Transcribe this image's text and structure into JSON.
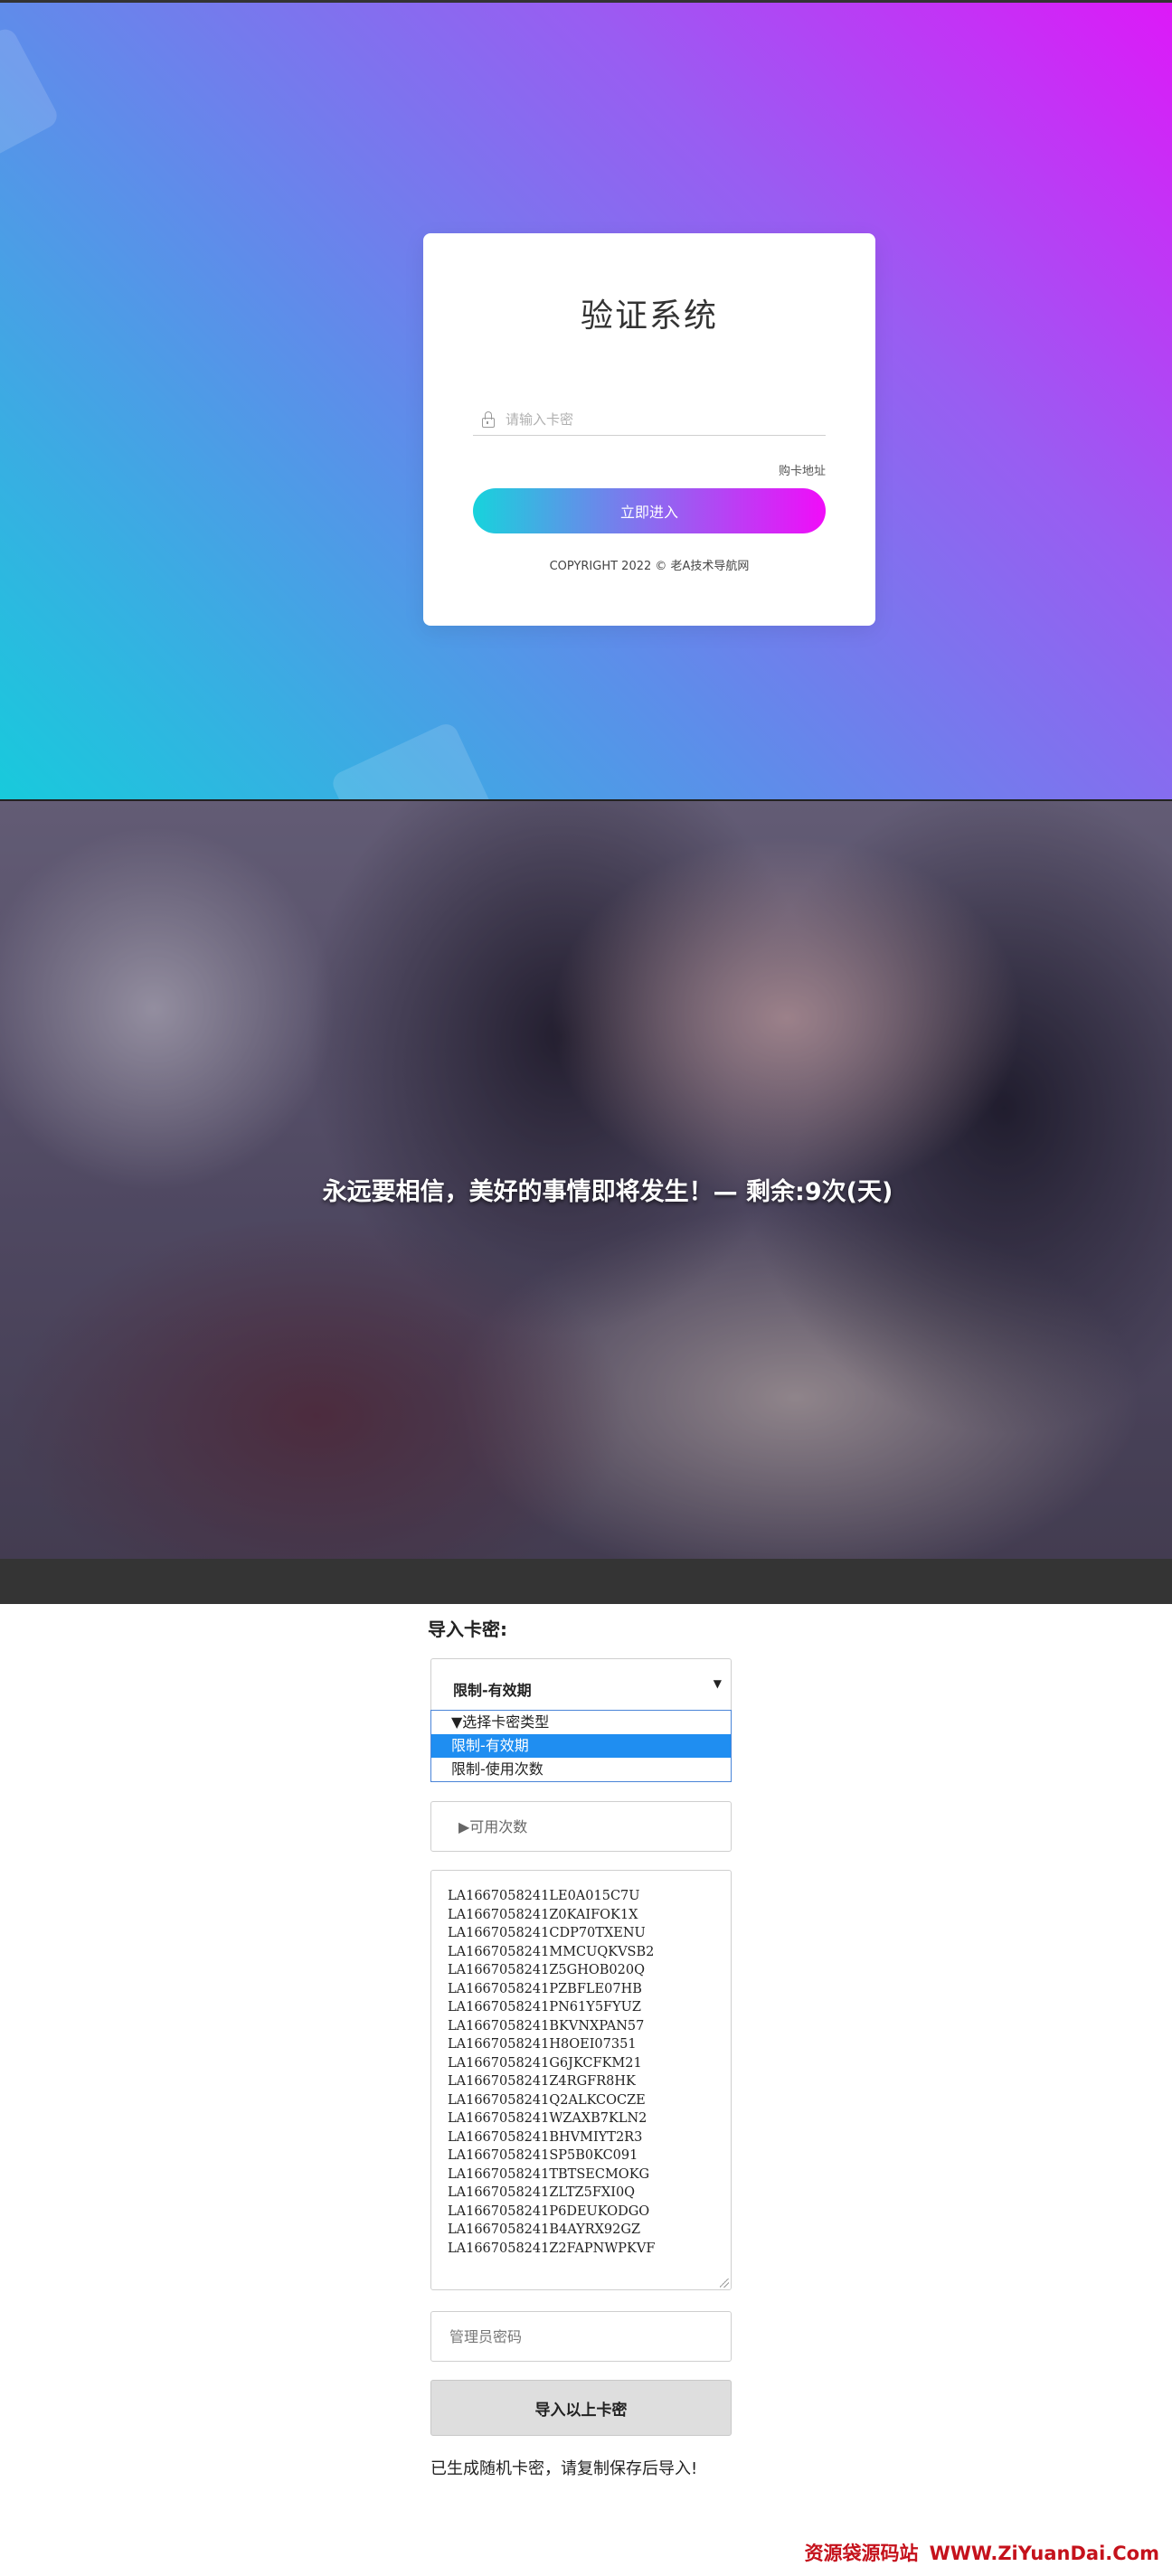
{
  "login": {
    "title": "验证系统",
    "card_placeholder": "请输入卡密",
    "buy_link": "购卡地址",
    "enter_button": "立即进入",
    "copyright": "COPYRIGHT 2022 © 老A技术导航网"
  },
  "banner": {
    "quote": "永远要相信，美好的事情即将发生！— 剩余:9次(天)"
  },
  "import": {
    "label": "导入卡密:",
    "select_value": "限制-有效期",
    "options": [
      "▼选择卡密类型",
      "限制-有效期",
      "限制-使用次数"
    ],
    "selected_option_index": 1,
    "count_placeholder": "▶可用次数",
    "codes": [
      "LA1667058241LE0A015C7U",
      "LA1667058241Z0KAIFOK1X",
      "LA1667058241CDP70TXENU",
      "LA1667058241MMCUQKVSB2",
      "LA1667058241Z5GHOB020Q",
      "LA1667058241PZBFLE07HB",
      "LA1667058241PN61Y5FYUZ",
      "LA1667058241BKVNXPAN57",
      "LA1667058241H8OEI07351",
      "LA1667058241G6JKCFKM21",
      "LA1667058241Z4RGFR8HK",
      "LA1667058241Q2ALKCOCZE",
      "LA1667058241WZAXB7KLN2",
      "LA1667058241BHVMIYT2R3",
      "LA1667058241SP5B0KC091",
      "LA1667058241TBTSECMOKG",
      "LA1667058241ZLTZ5FXI0Q",
      "LA1667058241P6DEUKODGO",
      "LA1667058241B4AYRX92GZ",
      "LA1667058241Z2FAPNWPKVF"
    ],
    "admin_placeholder": "管理员密码",
    "import_button": "导入以上卡密",
    "status": "已生成随机卡密，请复制保存后导入!"
  },
  "watermark": {
    "site": "资源袋源码站",
    "url": "WWW.ZiYuanDai.Com"
  },
  "colors": {
    "gradient_start": "#18cadc",
    "gradient_end": "#dd19f8",
    "dropdown_selected": "#1f8ef1",
    "watermark": "#c5121c"
  }
}
